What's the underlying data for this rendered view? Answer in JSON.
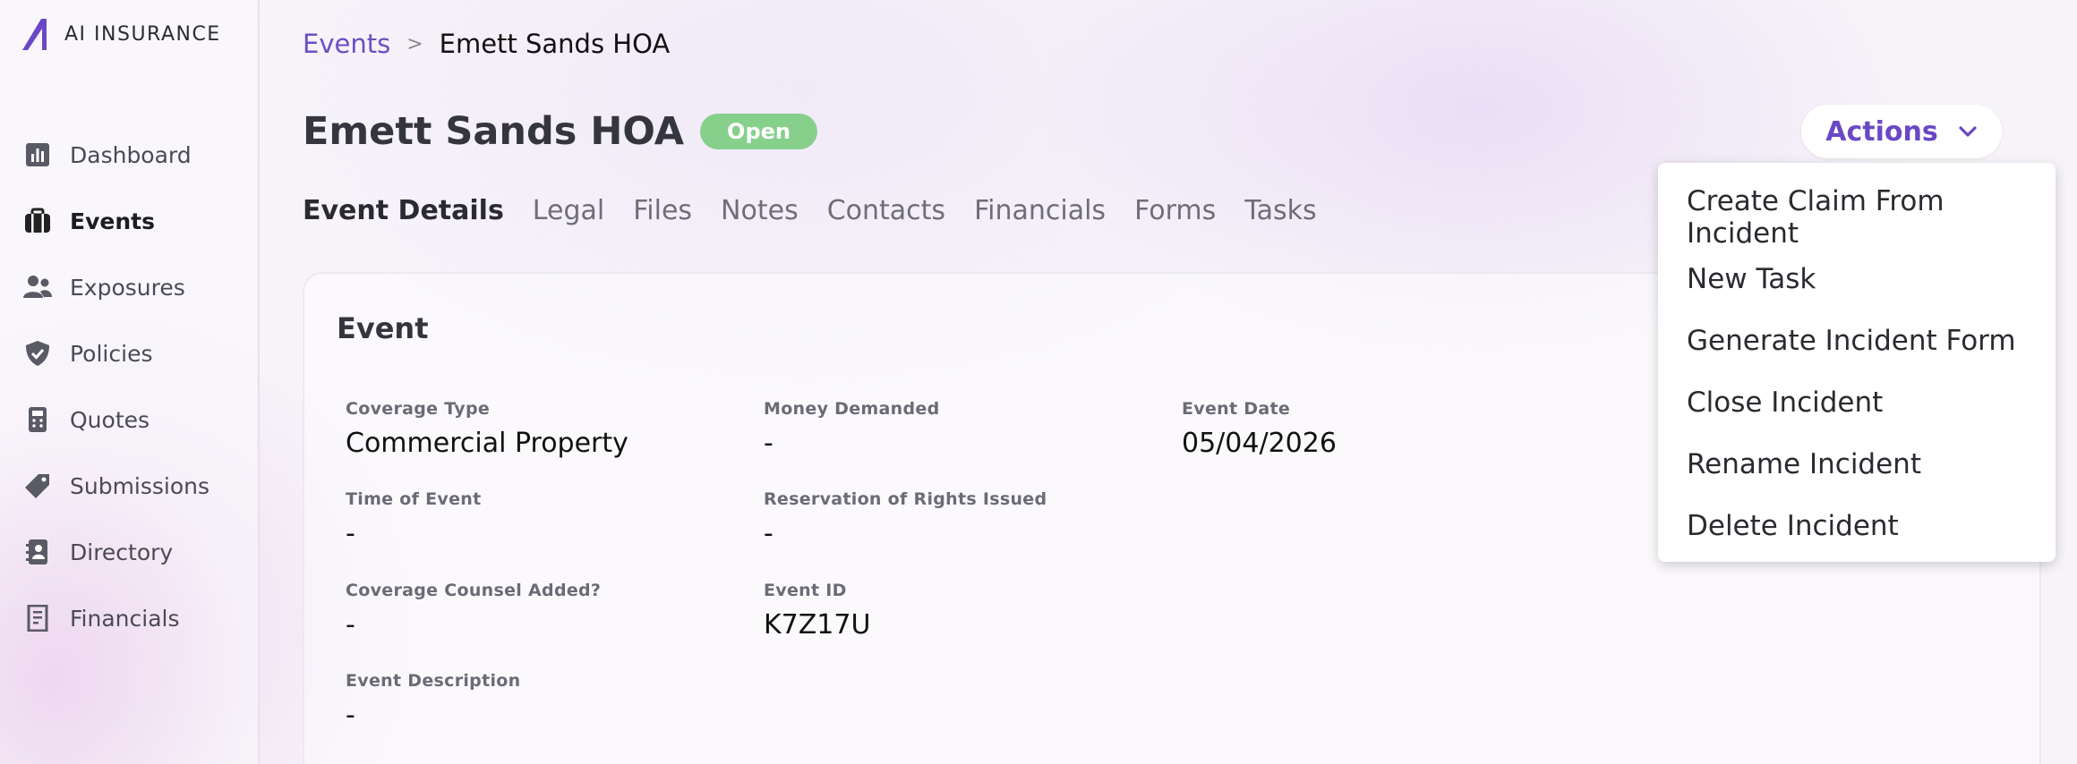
{
  "brand": {
    "name": "AI INSURANCE",
    "color": "#6a48c5"
  },
  "sidebar": {
    "items": [
      {
        "label": "Dashboard",
        "icon": "bar-chart-icon"
      },
      {
        "label": "Events",
        "icon": "briefcase-icon",
        "active": true
      },
      {
        "label": "Exposures",
        "icon": "people-icon"
      },
      {
        "label": "Policies",
        "icon": "shield-check-icon"
      },
      {
        "label": "Quotes",
        "icon": "calculator-icon"
      },
      {
        "label": "Submissions",
        "icon": "tag-icon"
      },
      {
        "label": "Directory",
        "icon": "contact-book-icon"
      },
      {
        "label": "Financials",
        "icon": "receipt-icon"
      }
    ]
  },
  "breadcrumb": {
    "parent": "Events",
    "separator": ">",
    "current": "Emett Sands HOA"
  },
  "header": {
    "title": "Emett Sands HOA",
    "status": "Open",
    "status_color": "#86d08c",
    "actions_label": "Actions"
  },
  "tabs": [
    "Event Details",
    "Legal",
    "Files",
    "Notes",
    "Contacts",
    "Financials",
    "Forms",
    "Tasks"
  ],
  "card": {
    "title": "Event",
    "fields": {
      "coverage_type": {
        "label": "Coverage Type",
        "value": "Commercial Property"
      },
      "money_demanded": {
        "label": "Money Demanded",
        "value": "-"
      },
      "event_date": {
        "label": "Event Date",
        "value": "05/04/2026"
      },
      "time_of_event": {
        "label": "Time of Event",
        "value": "-"
      },
      "reservation": {
        "label": "Reservation of Rights Issued",
        "value": "-"
      },
      "coverage_counsel": {
        "label": "Coverage Counsel Added?",
        "value": "-"
      },
      "event_id": {
        "label": "Event ID",
        "value": "K7Z17U"
      },
      "description": {
        "label": "Event Description",
        "value": "-"
      }
    }
  },
  "actions_menu": {
    "items": [
      "Create Claim From Incident",
      "New Task",
      "Generate Incident Form",
      "Close Incident",
      "Rename Incident",
      "Delete Incident"
    ]
  }
}
